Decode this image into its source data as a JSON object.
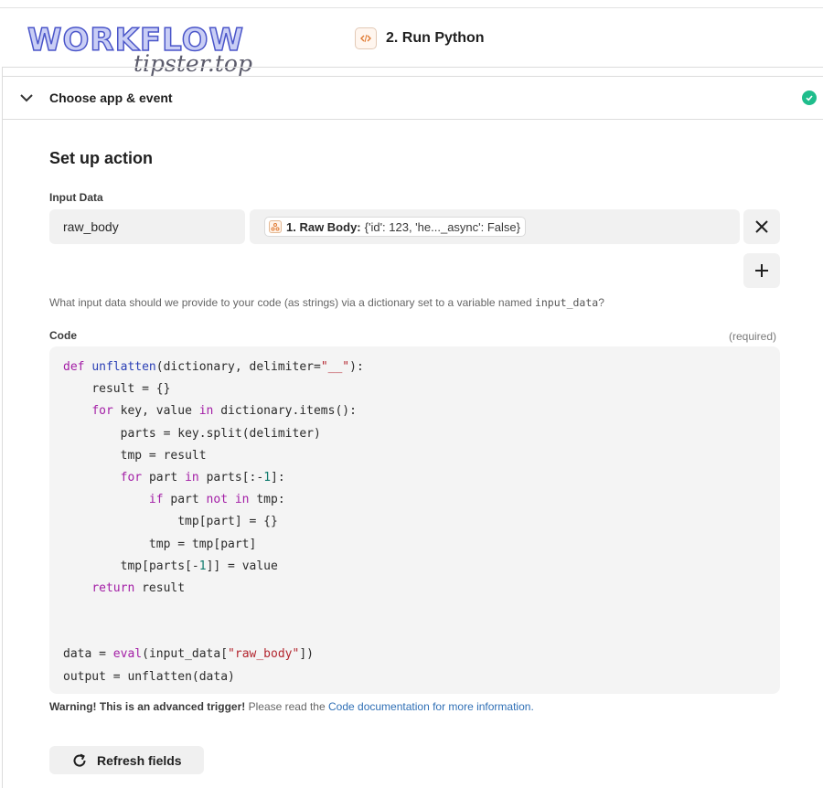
{
  "watermark": {
    "main": "WORKFLOW",
    "sub": "tipster.top"
  },
  "step": {
    "title": "2. Run Python",
    "icon": "code-icon"
  },
  "section": {
    "label": "Choose app & event",
    "status_icon": "check-circle-icon"
  },
  "setup": {
    "title": "Set up action"
  },
  "input_data": {
    "label": "Input Data",
    "key": "raw_body",
    "pill_strong": "1. Raw Body:",
    "pill_value": "{'id': 123, 'he..._async': False}",
    "help_text_prefix": "What input data should we provide to your code (as strings) via a dictionary set to a variable named ",
    "help_code": "input_data",
    "help_text_suffix": "?"
  },
  "code": {
    "label": "Code",
    "required": "(required)",
    "lines": [
      "def unflatten(dictionary, delimiter=\"__\"):",
      "    result = {}",
      "    for key, value in dictionary.items():",
      "        parts = key.split(delimiter)",
      "        tmp = result",
      "        for part in parts[:-1]:",
      "            if part not in tmp:",
      "                tmp[part] = {}",
      "            tmp = tmp[part]",
      "        tmp[parts[-1]] = value",
      "    return result",
      "",
      "",
      "data = eval(input_data[\"raw_body\"])",
      "output = unflatten(data)"
    ]
  },
  "warning": {
    "strong": "Warning! This is an advanced trigger!",
    "text": " Please read the ",
    "link": "Code documentation for more information."
  },
  "refresh": {
    "label": "Refresh fields"
  },
  "colors": {
    "success": "#1fbd8c",
    "link": "#2f6fb5",
    "keyword": "#a31ea6",
    "function": "#2a3fb5",
    "string": "#b3262f"
  }
}
